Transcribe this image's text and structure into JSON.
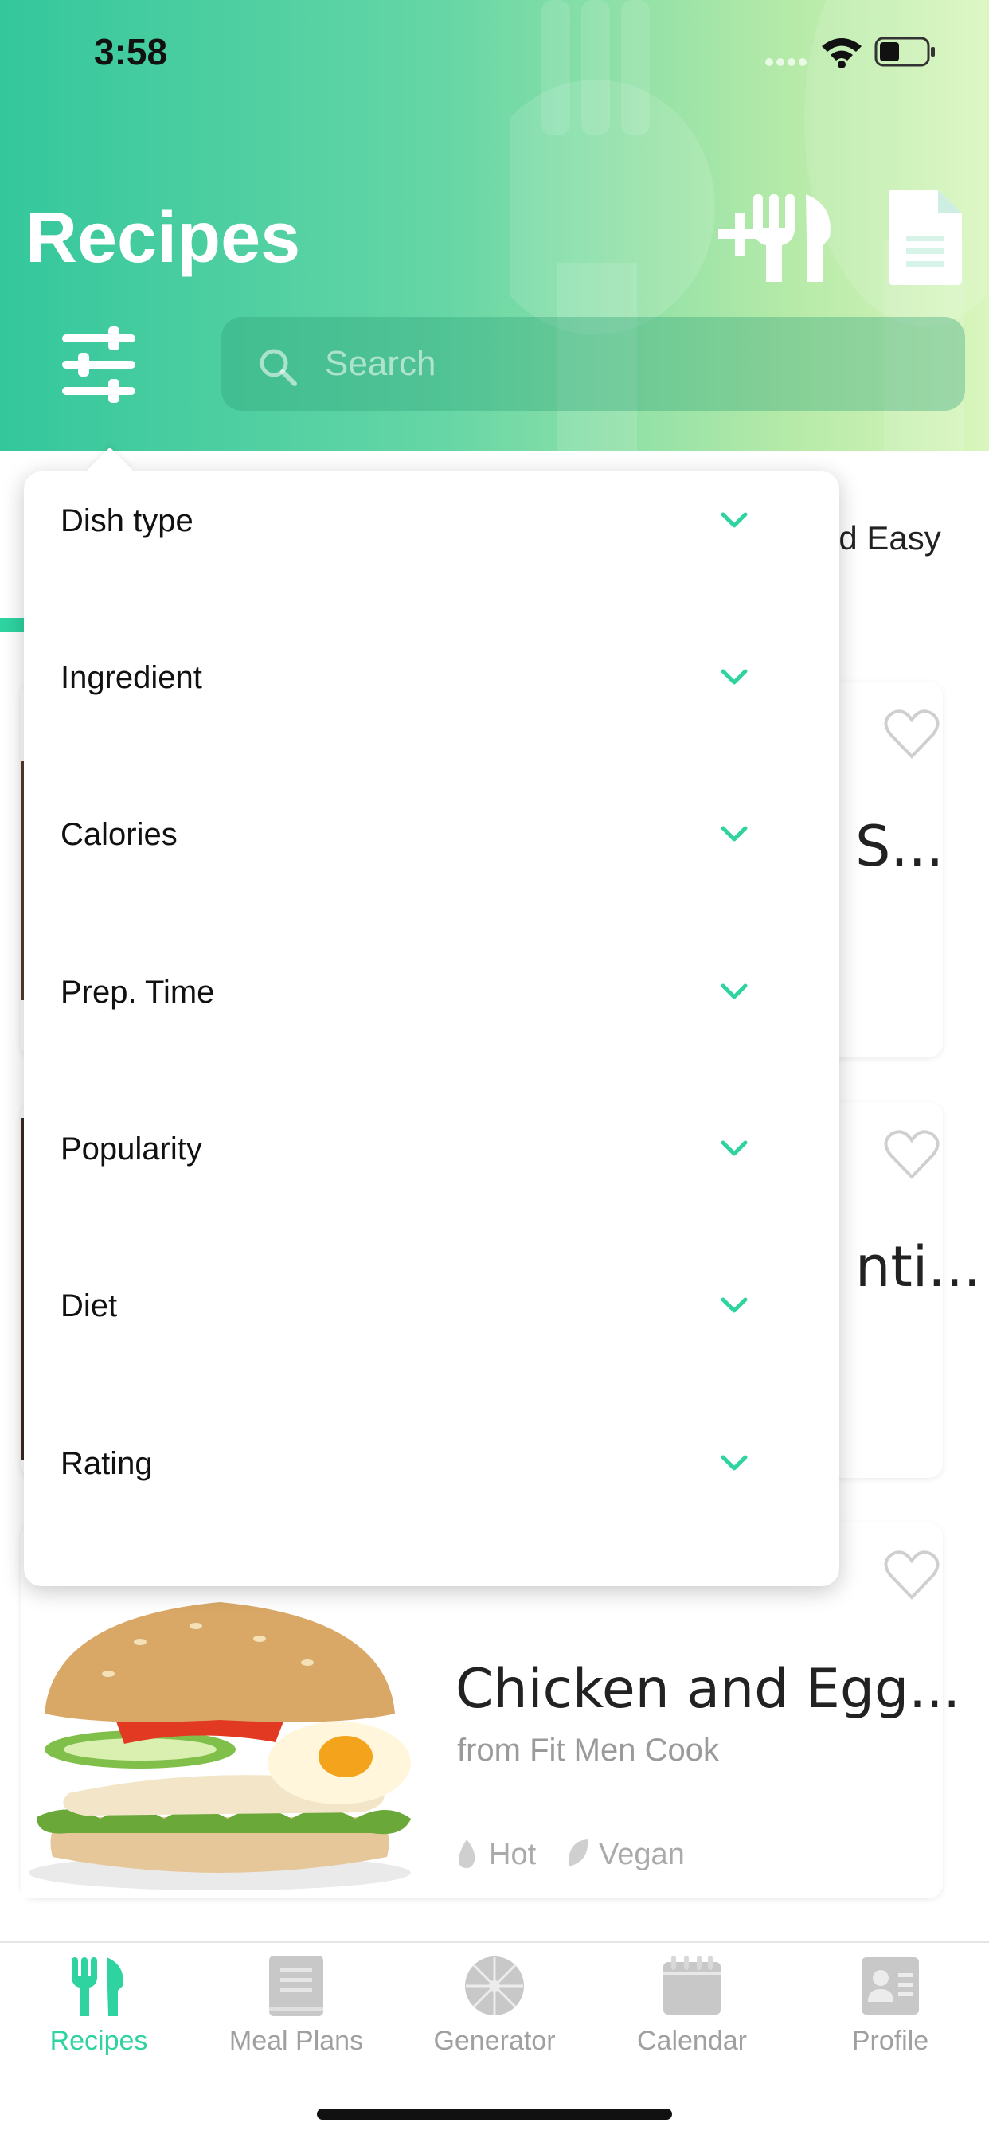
{
  "status": {
    "time": "3:58"
  },
  "header": {
    "title": "Recipes"
  },
  "search": {
    "placeholder": "Search"
  },
  "background": {
    "tab_fragment": "nd Easy",
    "cards": [
      {
        "title_fragment": "S..."
      },
      {
        "title_fragment": "nti..."
      },
      {
        "title": "Chicken and Egg...",
        "source": "from Fit Men Cook",
        "tags": [
          "Hot",
          "Vegan"
        ]
      }
    ]
  },
  "filters": [
    {
      "label": "Dish type"
    },
    {
      "label": "Ingredient"
    },
    {
      "label": "Calories"
    },
    {
      "label": "Prep. Time"
    },
    {
      "label": "Popularity"
    },
    {
      "label": "Diet"
    },
    {
      "label": "Rating"
    }
  ],
  "tabs": [
    {
      "label": "Recipes",
      "icon": "fork-knife-icon",
      "active": true
    },
    {
      "label": "Meal Plans",
      "icon": "book-icon",
      "active": false
    },
    {
      "label": "Generator",
      "icon": "wheel-icon",
      "active": false
    },
    {
      "label": "Calendar",
      "icon": "calendar-icon",
      "active": false
    },
    {
      "label": "Profile",
      "icon": "profile-card-icon",
      "active": false
    }
  ],
  "colors": {
    "accent": "#2ed3a0",
    "header_start": "#34c79c",
    "header_end": "#d9f6bd",
    "inactive": "#a0a0a0"
  }
}
